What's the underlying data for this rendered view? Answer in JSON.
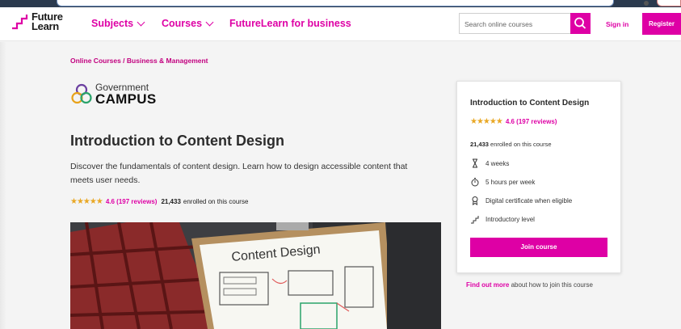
{
  "header": {
    "logo_line1": "Future",
    "logo_line2": "Learn",
    "nav": {
      "subjects": "Subjects",
      "courses": "Courses",
      "business": "FutureLearn for business"
    },
    "search_placeholder": "Search online courses",
    "signin": "Sign in",
    "register": "Register"
  },
  "breadcrumb": "Online Courses / Business & Management",
  "partner": {
    "line1": "Government",
    "line2": "CAMPUS"
  },
  "course": {
    "title": "Introduction to Content Design",
    "description": "Discover the fundamentals of content design. Learn how to design accessible content that meets user needs.",
    "rating_text": "4.6 (197 reviews)",
    "enrolled_count": "21,433",
    "enrolled_suffix": "enrolled on this course",
    "hero_image_text": "Content Design"
  },
  "card": {
    "title": "Introduction to Content Design",
    "rating_text": "4.6 (197 reviews)",
    "enrolled_count": "21,433",
    "enrolled_suffix": "enrolled on this course",
    "duration": "4 weeks",
    "effort": "5 hours per week",
    "certificate": "Digital certificate when eligible",
    "level": "Introductory level",
    "join_label": "Join course"
  },
  "find_out": {
    "link": "Find out more",
    "rest": "about how to join this course"
  },
  "colors": {
    "brand": "#de00a5",
    "star": "#e9a825"
  },
  "icons": [
    "search-icon",
    "chevron-down-icon",
    "hourglass-icon",
    "stopwatch-icon",
    "certificate-icon",
    "level-stairs-icon",
    "star-icon"
  ]
}
